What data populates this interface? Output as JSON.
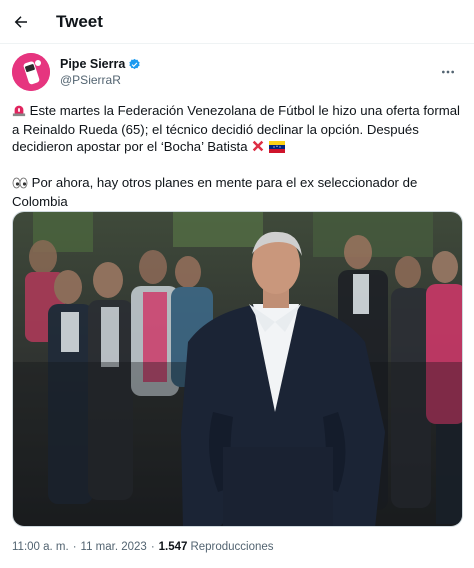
{
  "header": {
    "title": "Tweet"
  },
  "author": {
    "display_name": "Pipe Sierra",
    "handle": "@PSierraR"
  },
  "tweet": {
    "paragraph1_emoji": "siren-emoji",
    "paragraph1": "Este martes la Federación Venezolana de Fútbol le hizo una oferta formal a Reinaldo Rueda (65); el técnico decidió declinar la opción. Después decidieron apostar por el ‘Bocha’ Batista",
    "paragraph1_trailing_emojis": [
      "cross-mark-emoji",
      "venezuela-flag-emoji"
    ],
    "paragraph2_emoji": "eyes-emoji",
    "paragraph2": "Por ahora, hay otros planes en mente para el ex seleccionador de Colombia"
  },
  "meta": {
    "time": "11:00 a. m.",
    "separator": "·",
    "date": "11 mar. 2023",
    "views_count": "1.547",
    "views_label": "Reproducciones"
  },
  "colors": {
    "accent": "#1d9bf0",
    "text": "#0f1419",
    "secondary_text": "#536471",
    "avatar_bg": "#e6357f"
  },
  "icons": {
    "back": "arrow-left-icon",
    "verified": "verified-badge-icon",
    "more": "more-horizontal-icon"
  }
}
